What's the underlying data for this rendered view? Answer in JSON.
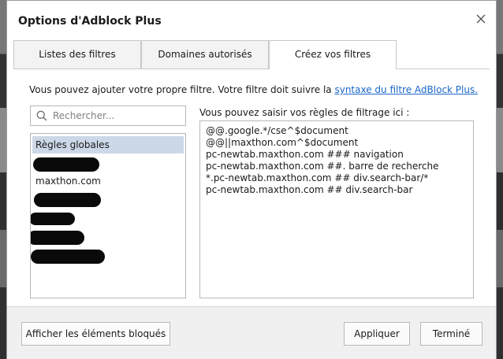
{
  "dialog": {
    "title": "Options d'Adblock Plus",
    "close_label": "×"
  },
  "tabs": [
    {
      "label": "Listes des filtres",
      "active": false
    },
    {
      "label": "Domaines autorisés",
      "active": false
    },
    {
      "label": "Créez vos filtres",
      "active": true
    }
  ],
  "intro": {
    "text": "Vous pouvez ajouter votre propre filtre. Votre filtre doit suivre la ",
    "link_text": "syntaxe du filtre AdBlock Plus."
  },
  "search": {
    "placeholder": "Rechercher...",
    "value": ""
  },
  "domains": {
    "items": [
      {
        "label": "Règles globales",
        "selected": true,
        "redacted": false
      },
      {
        "label": "",
        "selected": false,
        "redacted": true
      },
      {
        "label": "maxthon.com",
        "selected": false,
        "redacted": false
      },
      {
        "label": "",
        "selected": false,
        "redacted": true
      },
      {
        "label": "",
        "selected": false,
        "redacted": true
      },
      {
        "label": "",
        "selected": false,
        "redacted": true
      },
      {
        "label": "",
        "selected": false,
        "redacted": true
      }
    ]
  },
  "rules": {
    "label": "Vous pouvez saisir vos règles de filtrage ici :",
    "lines": [
      "@@.google.*/cse^$document",
      "@@||maxthon.com^$document",
      "pc-newtab.maxthon.com ### navigation",
      "pc-newtab.maxthon.com ##. barre de recherche",
      "*.pc-newtab.maxthon.com ## div.search-bar/*",
      "pc-newtab.maxthon.com ## div.search-bar"
    ]
  },
  "footer": {
    "show_blocked_label": "Afficher les éléments bloqués",
    "apply_label": "Appliquer",
    "done_label": "Terminé"
  },
  "colors": {
    "link": "#1a66c9",
    "selection": "#ccd8e8",
    "footer_bg": "#f0f0f0",
    "border": "#b8b8b8"
  }
}
